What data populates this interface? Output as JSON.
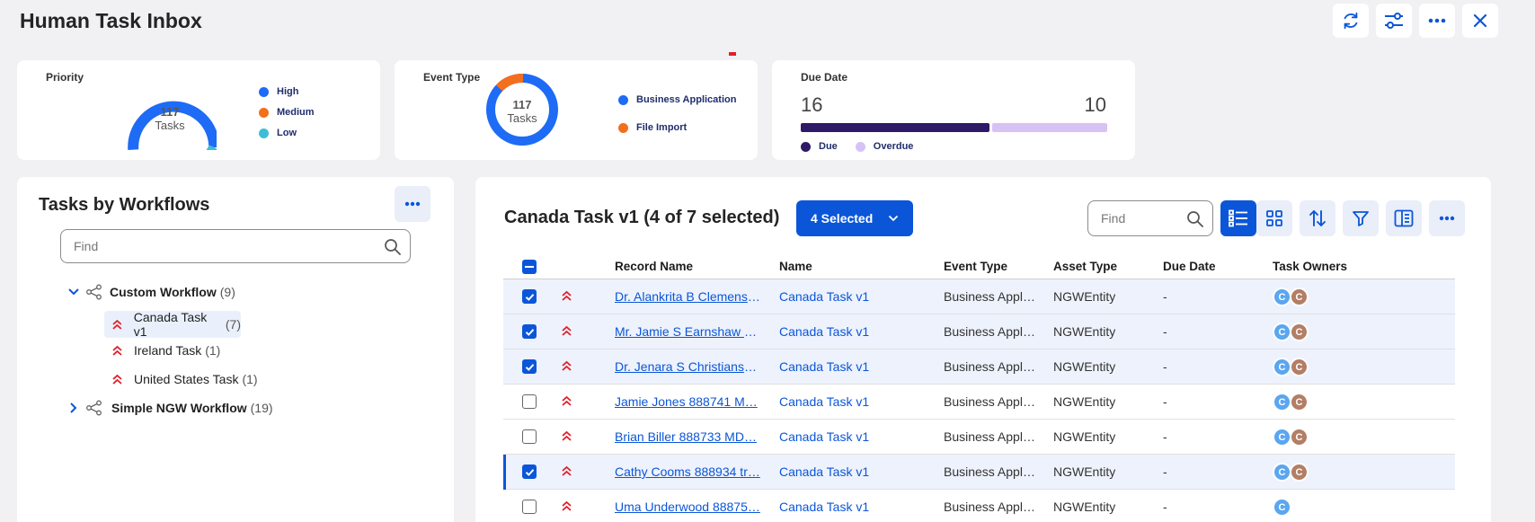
{
  "header": {
    "title": "Human Task Inbox",
    "buttons": [
      "refresh-icon",
      "sliders-icon",
      "more-icon",
      "close-icon"
    ]
  },
  "summary": {
    "priority": {
      "label": "Priority",
      "count": "117",
      "unit": "Tasks",
      "legend": [
        {
          "name": "High",
          "color": "#1e6bf5"
        },
        {
          "name": "Medium",
          "color": "#f46f1b"
        },
        {
          "name": "Low",
          "color": "#3fbdd6"
        }
      ]
    },
    "event_type": {
      "label": "Event Type",
      "count": "117",
      "unit": "Tasks",
      "legend": [
        {
          "name": "Business Application",
          "color": "#1e6bf5"
        },
        {
          "name": "File Import",
          "color": "#f46f1b"
        }
      ]
    },
    "due_date": {
      "label": "Due Date",
      "due_value": "16",
      "overdue_value": "10",
      "due_fraction": 0.615,
      "legend": [
        {
          "name": "Due",
          "color": "#2e1a66"
        },
        {
          "name": "Overdue",
          "color": "#d6c2f5"
        }
      ]
    }
  },
  "sidebar": {
    "title": "Tasks by Workflows",
    "search_placeholder": "Find",
    "workflows": [
      {
        "label": "Custom Workflow",
        "count": "(9)",
        "expanded": true,
        "tasks": [
          {
            "label": "Canada Task v1",
            "count": "(7)",
            "selected": true
          },
          {
            "label": "Ireland Task",
            "count": "(1)",
            "selected": false
          },
          {
            "label": "United States Task",
            "count": "(1)",
            "selected": false
          }
        ]
      },
      {
        "label": "Simple NGW Workflow",
        "count": "(19)",
        "expanded": false
      }
    ]
  },
  "main": {
    "title": "Canada Task v1 (4 of 7 selected)",
    "selected_button": "4 Selected",
    "search_placeholder": "Find",
    "columns": [
      "Record Name",
      "Name",
      "Event Type",
      "Asset Type",
      "Due Date",
      "Task Owners"
    ],
    "rows": [
      {
        "checked": true,
        "record": "Dr. Alankrita B Clemens …",
        "name": "Canada Task v1",
        "event": "Business Appl…",
        "asset": "NGWEntity",
        "due": "-",
        "owners": [
          "C",
          "C"
        ]
      },
      {
        "checked": true,
        "record": "Mr. Jamie S Earnshaw 7…",
        "name": "Canada Task v1",
        "event": "Business Appl…",
        "asset": "NGWEntity",
        "due": "-",
        "owners": [
          "C",
          "C"
        ]
      },
      {
        "checked": true,
        "record": "Dr. Jenara S Christianse…",
        "name": "Canada Task v1",
        "event": "Business Appl…",
        "asset": "NGWEntity",
        "due": "-",
        "owners": [
          "C",
          "C"
        ]
      },
      {
        "checked": false,
        "record": "Jamie Jones 888741 M…",
        "name": "Canada Task v1",
        "event": "Business Appl…",
        "asset": "NGWEntity",
        "due": "-",
        "owners": [
          "C",
          "C"
        ]
      },
      {
        "checked": false,
        "record": "Brian Biller 888733 MD…",
        "name": "Canada Task v1",
        "event": "Business Appl…",
        "asset": "NGWEntity",
        "due": "-",
        "owners": [
          "C",
          "C"
        ]
      },
      {
        "checked": true,
        "active": true,
        "record": "Cathy Cooms 888934 tr…",
        "name": "Canada Task v1",
        "event": "Business Appl…",
        "asset": "NGWEntity",
        "due": "-",
        "owners": [
          "C",
          "C"
        ]
      },
      {
        "checked": false,
        "record": "Uma Underwood 88875…",
        "name": "Canada Task v1",
        "event": "Business Appl…",
        "asset": "NGWEntity",
        "due": "-",
        "owners": [
          "C"
        ]
      }
    ]
  },
  "colors": {
    "accent": "#0b56d8",
    "high_priority": "#e0202a",
    "owner_blue": "#5aa6f0",
    "owner_brown": "#b37e66"
  }
}
